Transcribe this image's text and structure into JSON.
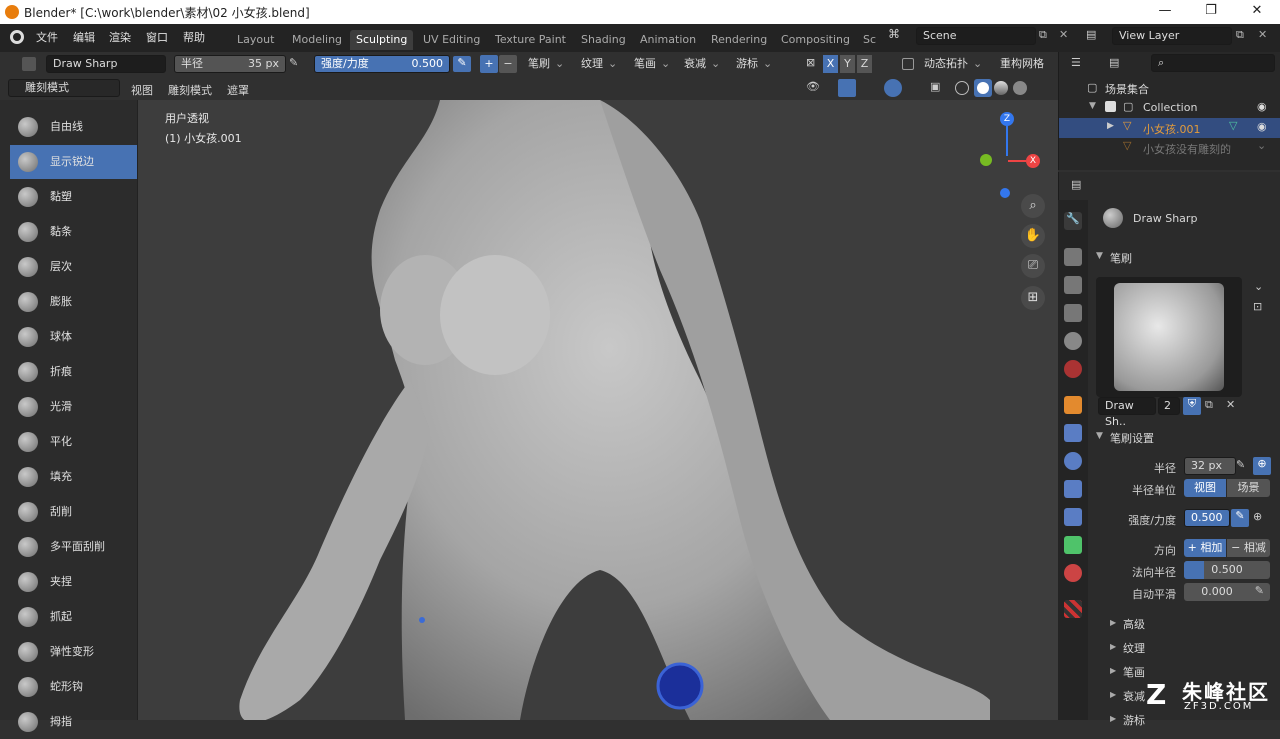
{
  "window": {
    "title": "Blender* [C:\\work\\blender\\素材\\02 小女孩.blend]",
    "min": "—",
    "max": "❐",
    "close": "✕"
  },
  "menus": [
    "文件",
    "编辑",
    "渲染",
    "窗口",
    "帮助"
  ],
  "workspaces": [
    "Layout",
    "Modeling",
    "Sculpting",
    "UV Editing",
    "Texture Paint",
    "Shading",
    "Animation",
    "Rendering",
    "Compositing",
    "Sc"
  ],
  "scene": {
    "label": "Scene",
    "view_layer": "View Layer"
  },
  "toolbar": {
    "brush_name": "Draw Sharp",
    "radius_label": "半径",
    "radius_value": "35 px",
    "strength_label": "强度/力度",
    "strength_value": "0.500",
    "plus": "+",
    "minus": "−",
    "dropdowns": [
      "笔刷",
      "纹理",
      "笔画",
      "衰减",
      "游标"
    ],
    "axes": [
      "X",
      "Y",
      "Z"
    ],
    "dyntopo": "动态拓扑",
    "remesh": "重构网格"
  },
  "header2": {
    "mode": "雕刻模式",
    "menus": [
      "视图",
      "雕刻模式",
      "遮罩"
    ]
  },
  "viewport": {
    "view_name": "用户透视",
    "object": "(1) 小女孩.001"
  },
  "tools": [
    "自由线",
    "显示锐边",
    "黏塑",
    "黏条",
    "层次",
    "膨胀",
    "球体",
    "折痕",
    "光滑",
    "平化",
    "填充",
    "刮削",
    "多平面刮削",
    "夹捏",
    "抓起",
    "弹性变形",
    "蛇形钩",
    "拇指"
  ],
  "active_tool_index": 1,
  "outliner": {
    "root": "场景集合",
    "collection": "Collection",
    "obj1": "小女孩.001",
    "obj2": "小女孩没有雕刻的"
  },
  "properties": {
    "brush_header": "Draw Sharp",
    "brush_section": "笔刷",
    "brush_slot_name": "Draw Sh..",
    "brush_users": "2",
    "settings_section": "笔刷设置",
    "radius_label": "半径",
    "radius_value": "32 px",
    "radius_unit_label": "半径单位",
    "unit_view": "视图",
    "unit_scene": "场景",
    "strength_label": "强度/力度",
    "strength_value": "0.500",
    "direction_label": "方向",
    "dir_add": "+ 相加",
    "dir_sub": "− 相减",
    "normal_radius_label": "法向半径",
    "normal_radius_value": "0.500",
    "autosmooth_label": "自动平滑",
    "autosmooth_value": "0.000",
    "subsections": [
      "高级",
      "纹理",
      "笔画",
      "衰减",
      "游标"
    ]
  },
  "watermark": {
    "brand": "朱峰社区",
    "url": "ZF3D.COM"
  },
  "colors": {
    "accent": "#4772b3",
    "active_object": "#e39b3a",
    "gizmo_x": "#ee4444",
    "gizmo_y": "#77bb22",
    "gizmo_z": "#3377ee"
  }
}
